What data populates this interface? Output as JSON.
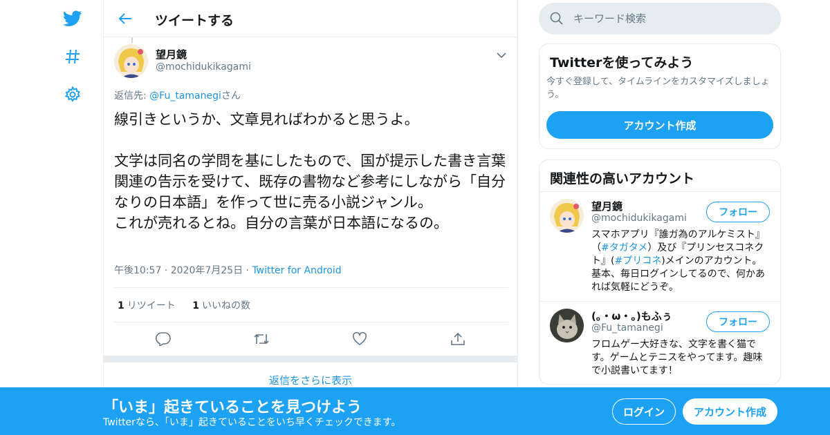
{
  "header": {
    "title": "ツイートする"
  },
  "tweet": {
    "author_name": "望月鏡",
    "author_handle": "@mochidukikagami",
    "reply_prefix": "返信先: ",
    "reply_to": "@Fu_tamanegi",
    "reply_suffix": "さん",
    "text": "線引きというか、文章見ればわかると思うよ。\n\n文学は同名の学問を基にしたもので、国が提示した書き言葉関連の告示を受けて、既存の書物など参考にしながら「自分なりの日本語」を作って世に売る小説ジャンル。\nこれが売れるとね。自分の言葉が日本語になるの。",
    "time": "午後10:57",
    "date": "2020年7月25日",
    "source": "Twitter for Android",
    "retweet_count": "1",
    "retweet_label": "リツイート",
    "like_count": "1",
    "like_label": "いいねの数"
  },
  "more_replies": "返信をさらに表示",
  "search": {
    "placeholder": "キーワード検索"
  },
  "signup_card": {
    "title": "Twitterを使ってみよう",
    "text": "今すぐ登録して、タイムラインをカスタマイズしましょう。",
    "button": "アカウント作成"
  },
  "related": {
    "title": "関連性の高いアカウント",
    "accounts": [
      {
        "name": "望月鏡",
        "handle": "@mochidukikagami",
        "follow": "フォロー",
        "bio_1": "スマホアプリ『誰ガ為のアルケミスト』（",
        "bio_tag1": "#タガタメ",
        "bio_2": "）及び『プリンセスコネクト』(",
        "bio_tag2": "#プリコネ",
        "bio_3": ")メインのアカウント。 基本、毎日ログインしてるので、何かあれば気軽にどうぞ。"
      },
      {
        "name": "(。・ω・。)もふぅ",
        "handle": "@Fu_tamanegi",
        "follow": "フォロー",
        "bio": "フロムゲー大好きな、文字を書く猫です。ゲームとテニスをやってます。趣味で小説書いてます！"
      }
    ]
  },
  "banner": {
    "headline": "「いま」起きていることを見つけよう",
    "sub": "Twitterなら、「いま」起きていることをいち早くチェックできます。",
    "login": "ログイン",
    "signup": "アカウント作成"
  },
  "colors": {
    "brand": "#1da1f2",
    "link": "#1b95e0",
    "muted": "#657786"
  }
}
